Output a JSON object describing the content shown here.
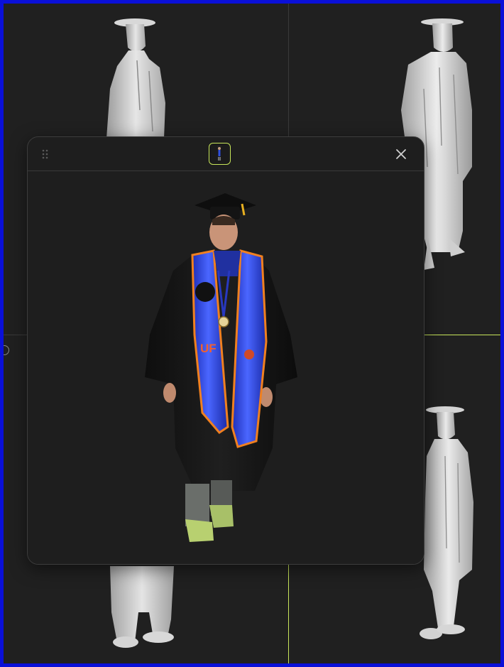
{
  "viewports": [
    {
      "name": "top-left",
      "content": "grayscale-3d-scan-front"
    },
    {
      "name": "top-right",
      "content": "grayscale-3d-scan-angled"
    },
    {
      "name": "bottom-left",
      "content": "grayscale-3d-scan-legs"
    },
    {
      "name": "bottom-right",
      "content": "grayscale-3d-scan-side"
    }
  ],
  "modal": {
    "thumbnail_icon": "person-scan-thumbnail-icon",
    "drag_icon": "drag-handle-icon",
    "close_icon": "close-icon",
    "image_subject": "graduate-in-gown-with-uf-stole",
    "stole_text": "UF"
  },
  "colors": {
    "frame_border": "#0a10d8",
    "background": "#202020",
    "accent": "#c8e65a",
    "stole_blue": "#2a3fd8",
    "stole_orange": "#f08020",
    "gown": "#151515"
  }
}
